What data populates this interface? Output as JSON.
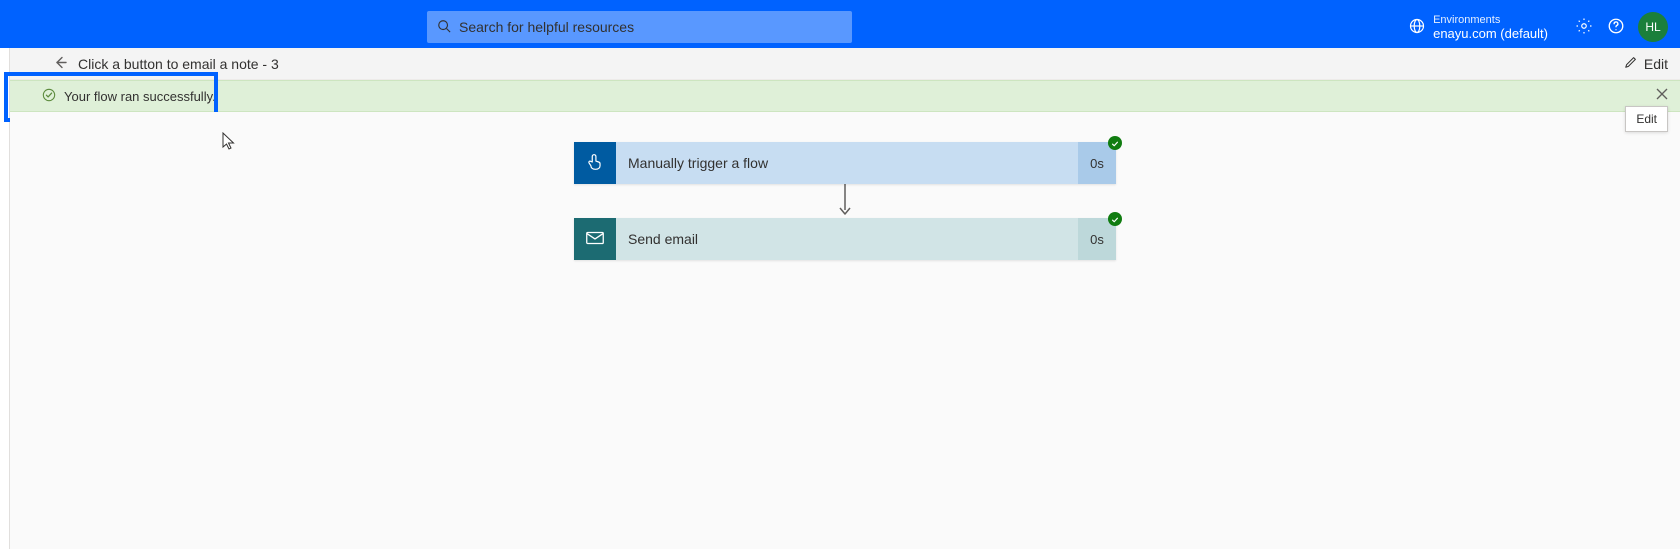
{
  "header": {
    "search_placeholder": "Search for helpful resources",
    "environments_label": "Environments",
    "environment_value": "enayu.com (default)",
    "avatar_initials": "HL"
  },
  "cmdbar": {
    "title": "Click a button to email a note - 3",
    "edit_label": "Edit"
  },
  "banner": {
    "message": "Your flow ran successfully."
  },
  "tooltip": {
    "edit": "Edit"
  },
  "steps": [
    {
      "label": "Manually trigger a flow",
      "duration": "0s"
    },
    {
      "label": "Send email",
      "duration": "0s"
    }
  ]
}
